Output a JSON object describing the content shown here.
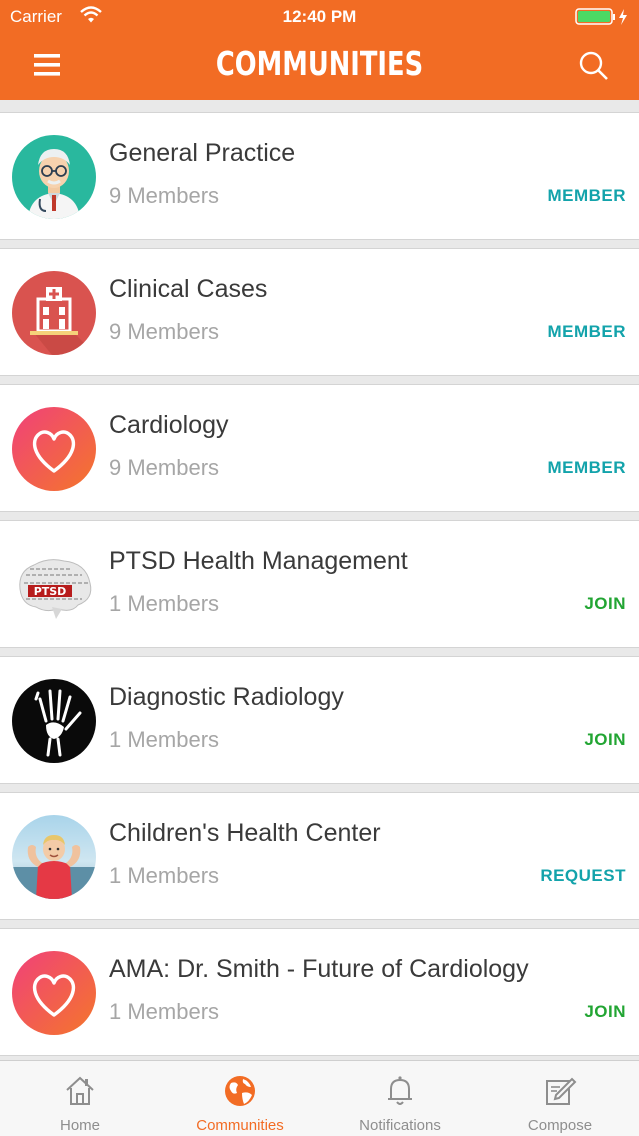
{
  "status_bar": {
    "carrier": "Carrier",
    "time": "12:40 PM"
  },
  "header": {
    "title": "COMMUNITIES"
  },
  "colors": {
    "brand": "#f26c24",
    "member": "#13a3ab",
    "join": "#22a533"
  },
  "communities": [
    {
      "name": "General Practice",
      "members": "9 Members",
      "action": "MEMBER",
      "icon": "doctor-avatar"
    },
    {
      "name": "Clinical Cases",
      "members": "9 Members",
      "action": "MEMBER",
      "icon": "hospital-icon"
    },
    {
      "name": "Cardiology",
      "members": "9 Members",
      "action": "MEMBER",
      "icon": "heart-icon"
    },
    {
      "name": "PTSD Health Management",
      "members": "1 Members",
      "action": "JOIN",
      "icon": "ptsd-brain-image",
      "image_text": "PTSD"
    },
    {
      "name": "Diagnostic Radiology",
      "members": "1 Members",
      "action": "JOIN",
      "icon": "xray-hand-icon"
    },
    {
      "name": "Children's Health Center",
      "members": "1 Members",
      "action": "REQUEST",
      "icon": "child-photo"
    },
    {
      "name": "AMA: Dr. Smith - Future of Cardiology",
      "members": "1 Members",
      "action": "JOIN",
      "icon": "heart-icon"
    }
  ],
  "tabs": [
    {
      "label": "Home",
      "icon": "home-icon",
      "active": false
    },
    {
      "label": "Communities",
      "icon": "globe-icon",
      "active": true
    },
    {
      "label": "Notifications",
      "icon": "bell-icon",
      "active": false
    },
    {
      "label": "Compose",
      "icon": "compose-icon",
      "active": false
    }
  ]
}
